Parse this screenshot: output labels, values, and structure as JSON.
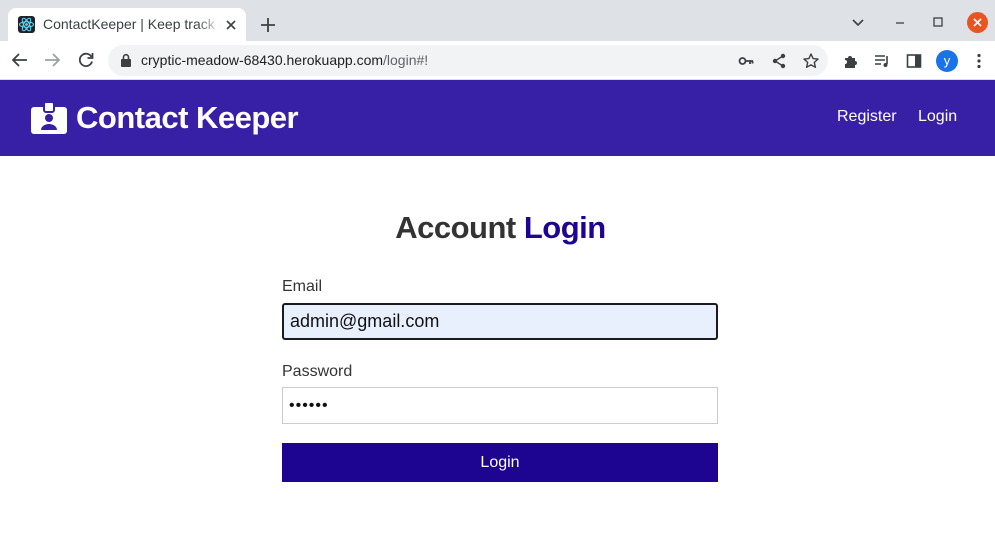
{
  "browser": {
    "tab_title": "ContactKeeper | Keep track of your contacts",
    "url_host": "cryptic-meadow-68430.herokuapp.com",
    "url_path": "/login#!",
    "profile_initial": "y"
  },
  "navbar": {
    "brand": "Contact Keeper",
    "links": [
      "Register",
      "Login"
    ],
    "background": "#3720a6"
  },
  "form": {
    "heading_part1": "Account",
    "heading_part2": "Login",
    "email_label": "Email",
    "email_value": "admin@gmail.com",
    "password_label": "Password",
    "password_value": "••••••",
    "submit_label": "Login",
    "accent": "#1d0591"
  }
}
